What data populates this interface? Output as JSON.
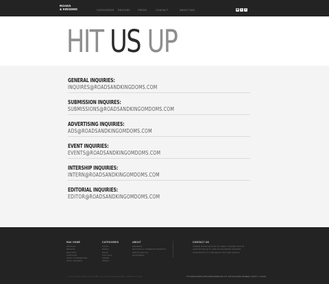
{
  "header": {
    "logo_line1": "ROADS",
    "logo_line2": "& KINGDMS",
    "nav": [
      "CATEGORIES",
      "REGIONS",
      "PRESS",
      "CONTACT",
      "ABOUT R&K"
    ],
    "social": [
      {
        "icon": "email-icon",
        "glyph": "✉"
      },
      {
        "icon": "twitter-icon",
        "glyph": "t"
      },
      {
        "icon": "facebook-icon",
        "glyph": "f"
      }
    ]
  },
  "hero": {
    "word1": "HIT",
    "word2": "US",
    "word3": "UP"
  },
  "inquiries": [
    {
      "label": "GENERAL INQUIRIES:",
      "email": "INQUIRES@ROADSANDKINGDOMS.COM"
    },
    {
      "label": "SUBMISSION INQUIRES:",
      "email": "SUBMISSIONS@ROADSANDKINGOMDOMS.COM"
    },
    {
      "label": "ADVERTISING INQUIRIES:",
      "email": "ADS@ROADSANDKINGOMDOMS.COM"
    },
    {
      "label": "EVENT INQUIRIES:",
      "email": "EVENTS@ROADSANDKINGOMDOMS.COM"
    },
    {
      "label": "INTERSHIP INQUIRIES:",
      "email": "INTERN@ROADSANDKINGOMDOMS.COM"
    },
    {
      "label": "EDITORIAL INQUIRIES:",
      "email": "EDITOR@ROADSANDKINGOMDOMS.COM"
    }
  ],
  "footer": {
    "col1": {
      "heading": "R&K HOME",
      "items": [
        "ARTICLE",
        "RECENT",
        "REGIONS",
        "POPULAR",
        "MOST COMMENTED",
        "MOST SHARED"
      ]
    },
    "col2": {
      "heading": "CATEGORIES",
      "items": [
        "FOOD",
        "DRINK",
        "SHOP",
        "POLITICS",
        "CRIME",
        "MEDIA"
      ]
    },
    "col3": {
      "heading": "ABOUT",
      "items": [
        "GENERAL",
        "EDITORS & CORRESPONDENTS",
        "WRITE FOR US",
        "MASTHEAD"
      ]
    },
    "col4": {
      "heading": "CONTACT US",
      "items": [
        "LOREM IPSUM DOLOR SIT AMET, CONSECTETUR",
        "ADIPISICING ELIT, SED DO EIUSMOD TEMPOR",
        "INCIDIDUNT UT LABORE ET DOLORE MAGNA"
      ]
    },
    "copyright": "© 2013 ROADS AND KINGDOMS. ALL RIGHTS RESERVED. TERMS OF USE",
    "credit": "TS ASSOCIATES WITH KINGDOMS INC ST. 123 NOTHING STREET | HOST + LOGIN"
  }
}
